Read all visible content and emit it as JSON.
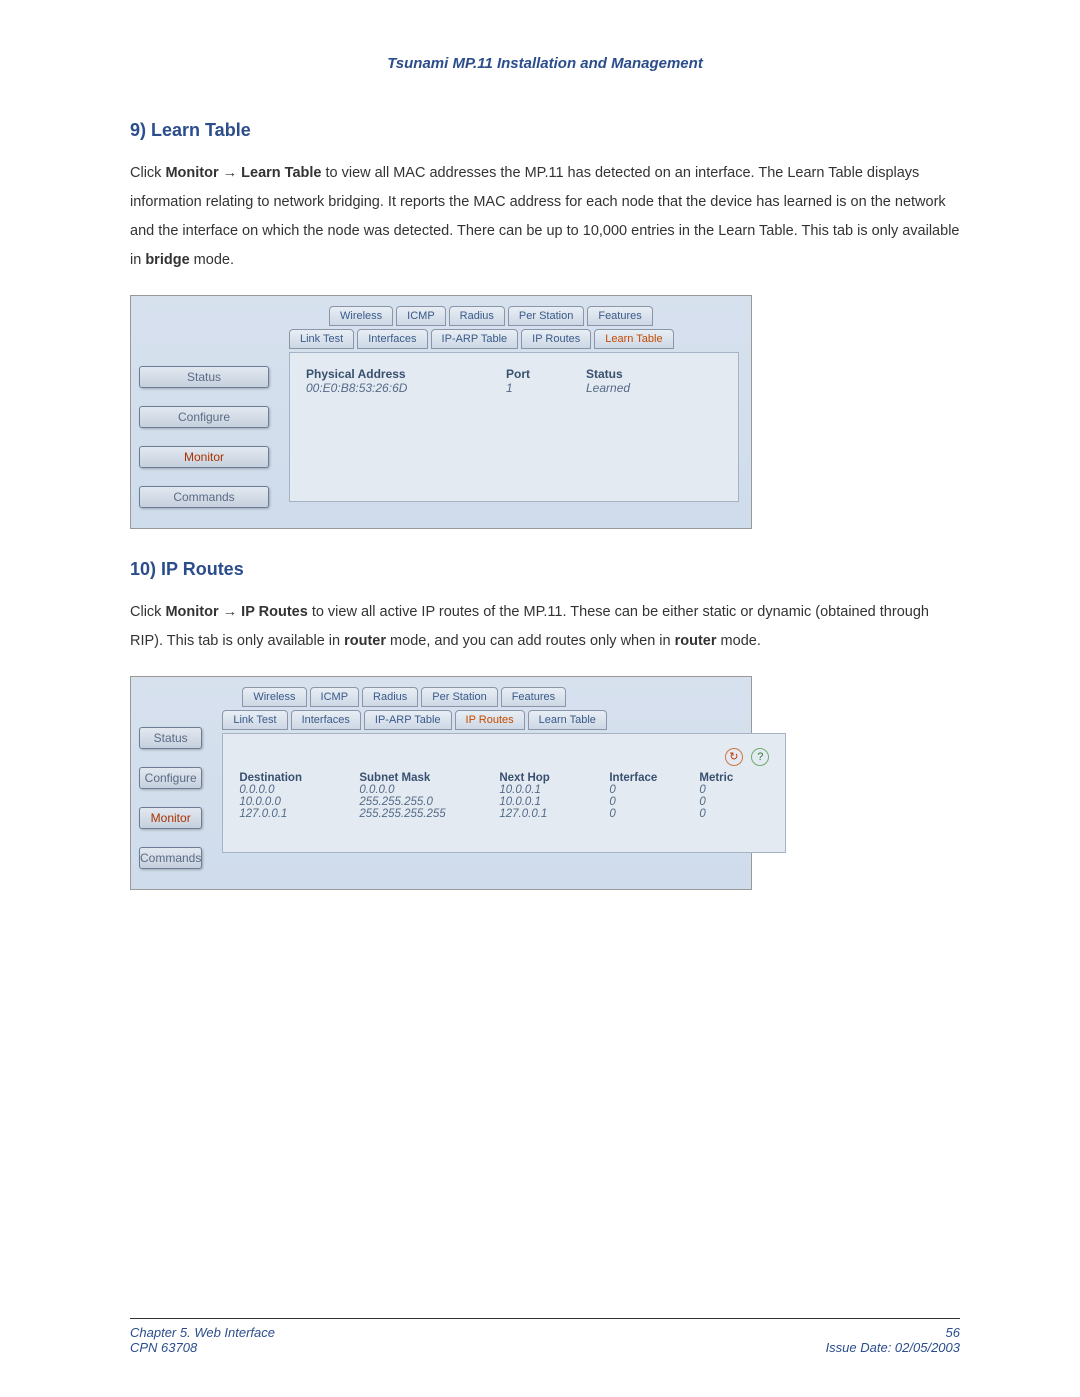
{
  "doc_title": "Tsunami MP.11 Installation and Management",
  "section9": {
    "heading": "9) Learn Table",
    "p1a": "Click ",
    "p1b": "Monitor",
    "p1c": " → ",
    "p1d": "Learn Table",
    "p1e": " to view all MAC addresses the MP.11 has detected on an interface.  The Learn Table displays information relating to network bridging.  It reports the MAC address for each node that the device has learned is on the network and the interface on which the node was detected.  There can  be up to 10,000 entries in the Learn Table.  This tab is only available in ",
    "p1f": "bridge",
    "p1g": " mode."
  },
  "screenshot1": {
    "sidebar": [
      "Status",
      "Configure",
      "Monitor",
      "Commands"
    ],
    "sidebar_active_index": 2,
    "tabrow1": [
      "Wireless",
      "ICMP",
      "Radius",
      "Per Station",
      "Features"
    ],
    "tabrow1_active": -1,
    "tabrow2": [
      "Link Test",
      "Interfaces",
      "IP-ARP Table",
      "IP Routes",
      "Learn Table"
    ],
    "tabrow2_active": 4,
    "learn_headers": [
      "Physical Address",
      "Port",
      "Status"
    ],
    "learn_row": [
      "00:E0:B8:53:26:6D",
      "1",
      "Learned"
    ]
  },
  "section10": {
    "heading": "10) IP Routes",
    "p1a": "Click ",
    "p1b": "Monitor",
    "p1c": " → ",
    "p1d": "IP Routes",
    "p1e": " to view all active IP routes of the MP.11.  These can be either static or dynamic (obtained through RIP).  This tab is only available in ",
    "p1f": "router",
    "p1g": " mode, and you can add routes only when in ",
    "p1h": "router",
    "p1i": " mode."
  },
  "screenshot2": {
    "sidebar": [
      "Status",
      "Configure",
      "Monitor",
      "Commands"
    ],
    "sidebar_active_index": 2,
    "tabrow1": [
      "Wireless",
      "ICMP",
      "Radius",
      "Per Station",
      "Features"
    ],
    "tabrow2": [
      "Link Test",
      "Interfaces",
      "IP-ARP Table",
      "IP Routes",
      "Learn Table"
    ],
    "tabrow2_active": 3,
    "ip_headers": [
      "Destination",
      "Subnet Mask",
      "Next Hop",
      "Interface",
      "Metric"
    ],
    "ip_rows": [
      [
        "0.0.0.0",
        "0.0.0.0",
        "10.0.0.1",
        "0",
        "0"
      ],
      [
        "10.0.0.0",
        "255.255.255.0",
        "10.0.0.1",
        "0",
        "0"
      ],
      [
        "127.0.0.1",
        "255.255.255.255",
        "127.0.0.1",
        "0",
        "0"
      ]
    ]
  },
  "footer": {
    "chapter": "Chapter 5.   Web Interface",
    "doc_number": "CPN 63708",
    "page": "56",
    "issue": "Issue Date:  02/05/2003"
  }
}
